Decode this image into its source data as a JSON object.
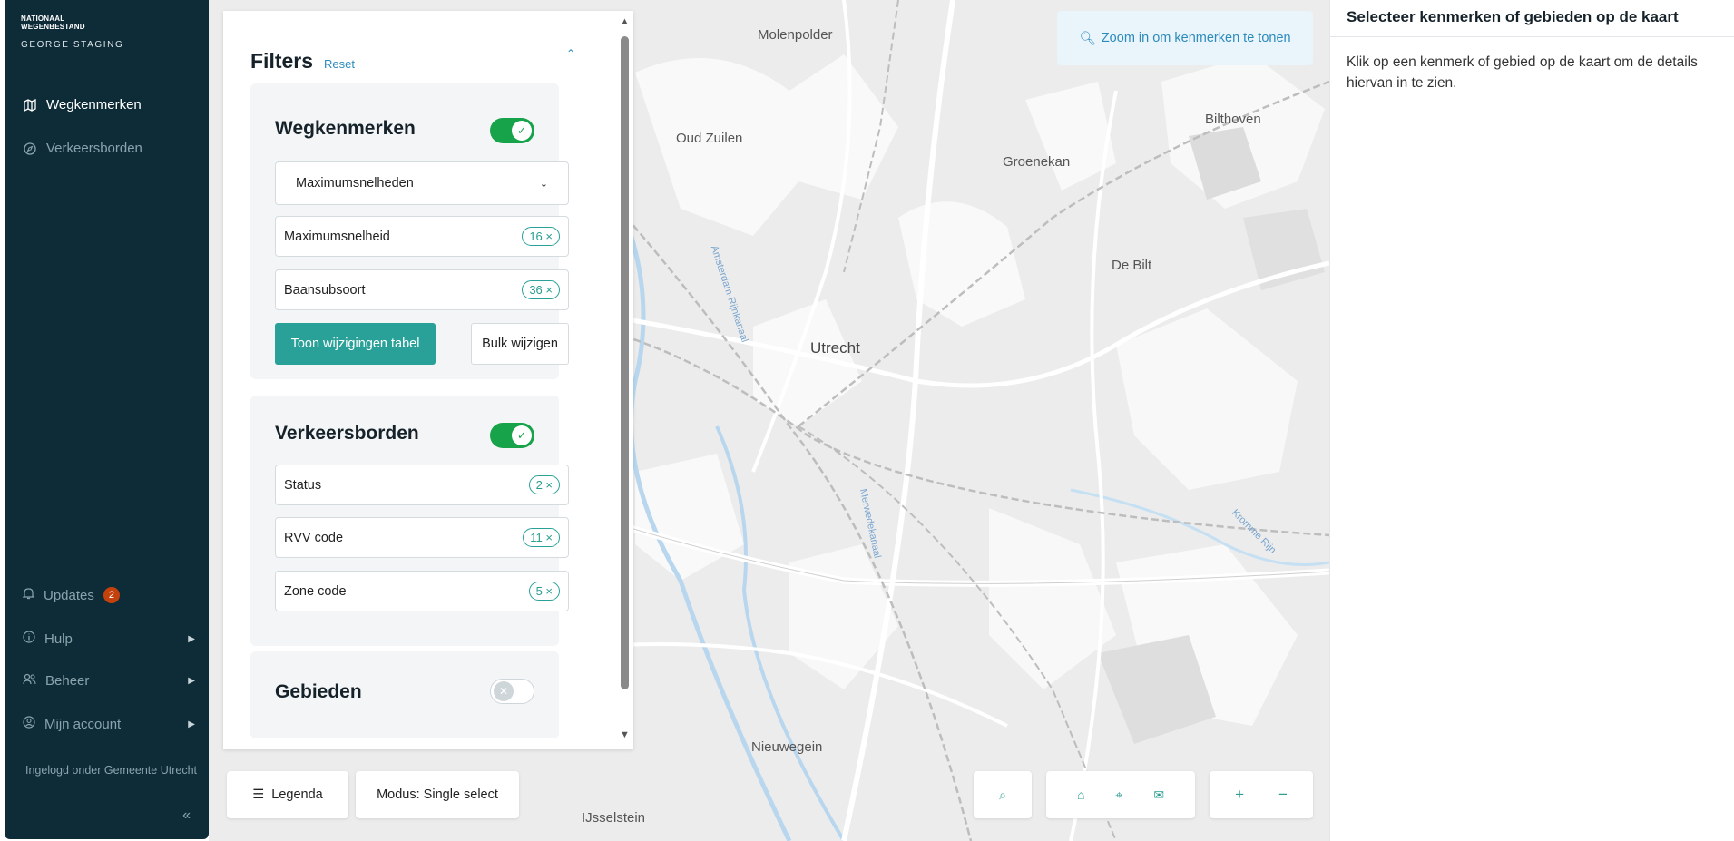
{
  "sidebar": {
    "brand_line1": "NATIONAAL",
    "brand_line2": "WEGENBESTAND",
    "brand_sub": "GEORGE STAGING",
    "nav": [
      {
        "label": "Wegkenmerken",
        "icon": "map-icon",
        "active": true
      },
      {
        "label": "Verkeersborden",
        "icon": "compass-icon",
        "active": false
      }
    ],
    "bottom": [
      {
        "label": "Updates",
        "icon": "bell-icon",
        "badge": "2"
      },
      {
        "label": "Hulp",
        "icon": "info-icon"
      },
      {
        "label": "Beheer",
        "icon": "users-icon"
      },
      {
        "label": "Mijn account",
        "icon": "account-icon"
      }
    ],
    "logged_in": "Ingelogd onder Gemeente Utrecht",
    "collapse_symbol": "«"
  },
  "filters": {
    "title": "Filters",
    "reset": "Reset",
    "wegkenmerken": {
      "title": "Wegkenmerken",
      "enabled": true,
      "select_value": "Maximumsnelheden",
      "fields": [
        {
          "label": "Maximumsnelheid",
          "count": "16 ×"
        },
        {
          "label": "Baansubsoort",
          "count": "36 ×"
        }
      ],
      "primary_button": "Toon wijzigingen tabel",
      "secondary_button": "Bulk wijzigen"
    },
    "verkeersborden": {
      "title": "Verkeersborden",
      "enabled": true,
      "fields": [
        {
          "label": "Status",
          "count": "2 ×"
        },
        {
          "label": "RVV code",
          "count": "11 ×"
        },
        {
          "label": "Zone code",
          "count": "5 ×"
        }
      ]
    },
    "gebieden": {
      "title": "Gebieden",
      "enabled": false
    }
  },
  "map": {
    "zoom_hint": "Zoom in om kenmerken te tonen",
    "labels": {
      "molenpolder": "Molenpolder",
      "oud_zuilen": "Oud Zuilen",
      "groenekan": "Groenekan",
      "bilthoven": "Bilthoven",
      "de_bilt": "De Bilt",
      "utrecht": "Utrecht",
      "nieuwegein": "Nieuwegein",
      "ijsselstein": "IJsselstein",
      "amsterdam_rijnkanaal": "Amsterdam-Rijnkanaal",
      "merwedekanaal": "Merwedekanaal",
      "kromme_rijn": "Kromme Rijn"
    },
    "legend_button": "Legenda",
    "mode_button": "Modus: Single select"
  },
  "details": {
    "title": "Selecteer kenmerken of gebieden op de kaart",
    "text": "Klik op een kenmerk of gebied op de kaart om de details hiervan in te zien."
  },
  "colors": {
    "sidebar_bg": "#0e2c38",
    "accent": "#2aa198",
    "toggle_on": "#16a34a",
    "link": "#2c8bbd",
    "badge": "#c2410c"
  }
}
